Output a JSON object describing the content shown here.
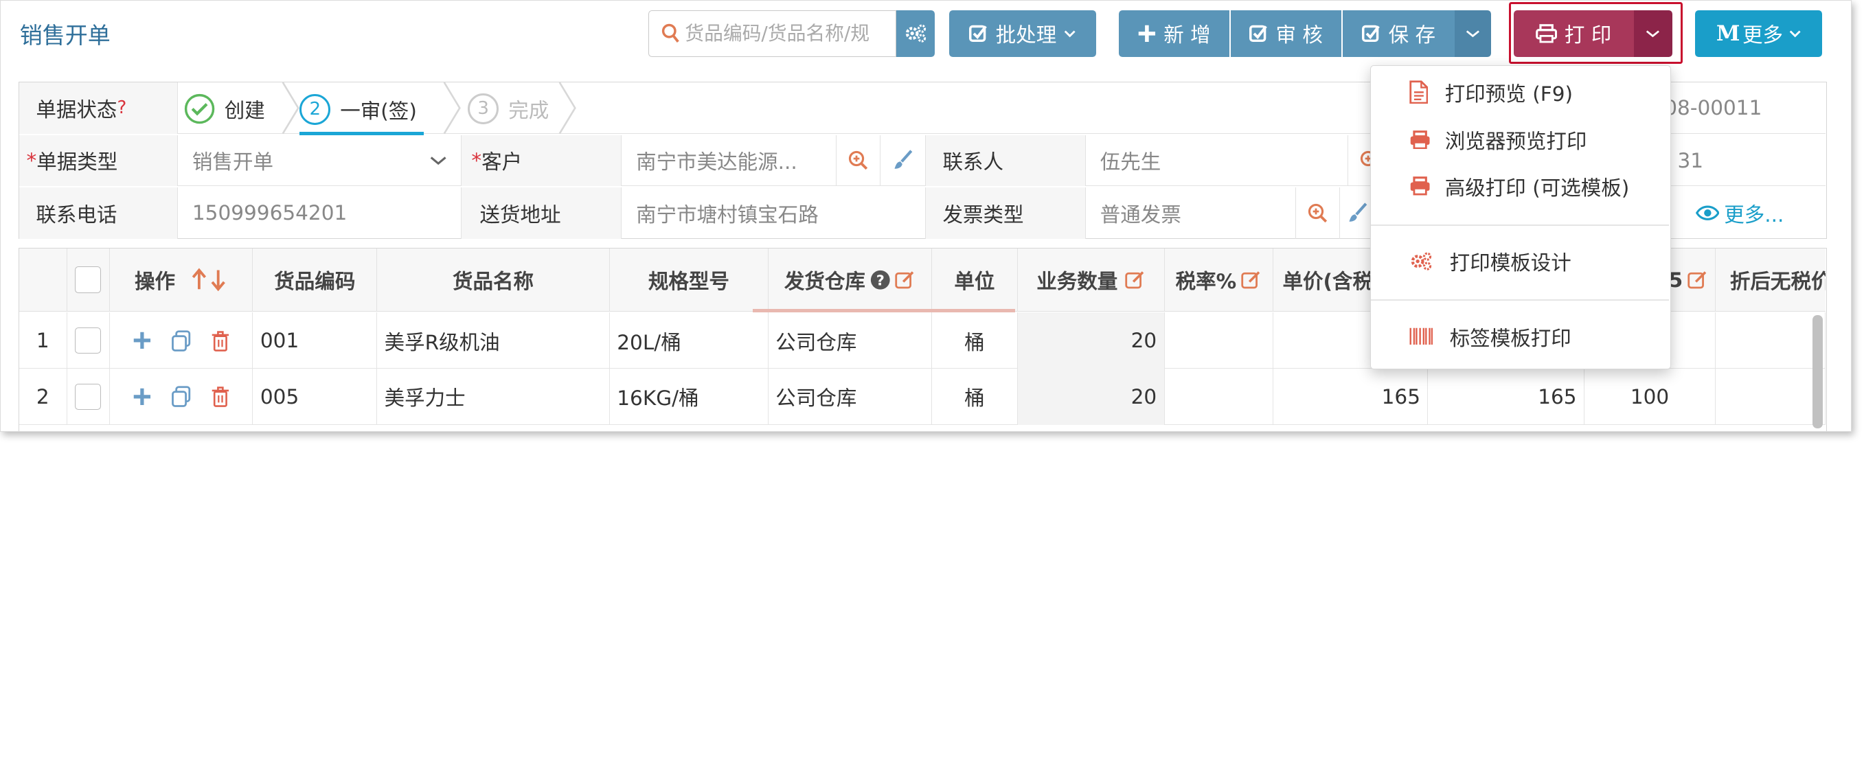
{
  "page_title": "销售开单",
  "search": {
    "placeholder": "货品编码/货品名称/规"
  },
  "toolbar": {
    "batch_label": "批处理",
    "add_label": "新 增",
    "approve_label": "审 核",
    "save_label": "保 存",
    "print_label": "打 印",
    "more_label": "更多",
    "more_letter": "M"
  },
  "status": {
    "label": "单据状态",
    "q": "?",
    "steps": [
      {
        "num": "",
        "label": "创建",
        "state": "done"
      },
      {
        "num": "2",
        "label": "一审(签)",
        "state": "active"
      },
      {
        "num": "3",
        "label": "完成",
        "state": "todo"
      }
    ],
    "doc_no": "8-08-00011"
  },
  "form": {
    "doc_type_label": "单据类型",
    "doc_type_value": "销售开单",
    "customer_label": "客户",
    "customer_value": "南宁市美达能源...",
    "contact_label": "联系人",
    "contact_value": "伍先生",
    "contact_phone_frag": "31",
    "phone_label": "联系电话",
    "phone_value": "150999654201",
    "address_label": "送货地址",
    "address_value": "南宁市塘村镇宝石路",
    "invoice_label": "发票类型",
    "invoice_value": "普通发票",
    "more_link": "更多..."
  },
  "grid": {
    "headers": {
      "ops": "操作",
      "code": "货品编码",
      "name": "货品名称",
      "spec": "规格型号",
      "warehouse": "发货仓库",
      "unit": "单位",
      "qty": "业务数量",
      "tax": "税率%",
      "price": "单价(含税",
      "h10_suffix": "5",
      "discount": "折后无税价"
    },
    "rows": [
      {
        "idx": "1",
        "code": "001",
        "name": "美孚R级机油",
        "spec": "20L/桶",
        "warehouse": "公司仓库",
        "unit": "桶",
        "qty": "20",
        "tax": "",
        "price": "",
        "c10": "",
        "c11": "",
        "c12": ""
      },
      {
        "idx": "2",
        "code": "005",
        "name": "美孚力士",
        "spec": "16KG/桶",
        "warehouse": "公司仓库",
        "unit": "桶",
        "qty": "20",
        "tax": "",
        "price": "165",
        "c10": "165",
        "c11": "100",
        "c12": ""
      }
    ]
  },
  "print_menu": {
    "items": [
      {
        "label": "打印预览 (F9)",
        "icon": "file-pdf-icon"
      },
      {
        "label": "浏览器预览打印",
        "icon": "printer-icon"
      },
      {
        "label": "高级打印 (可选模板)",
        "icon": "printer-icon"
      },
      {
        "label": "打印模板设计",
        "icon": "gears-icon"
      },
      {
        "label": "标签模板打印",
        "icon": "barcode-icon"
      }
    ]
  },
  "colors": {
    "accent": "#5a95b8",
    "print": "#a8375a",
    "more": "#1a9ec9",
    "highlight_box": "#c8102e",
    "step_done": "#5cb85c",
    "step_active": "#1ba6d6"
  }
}
